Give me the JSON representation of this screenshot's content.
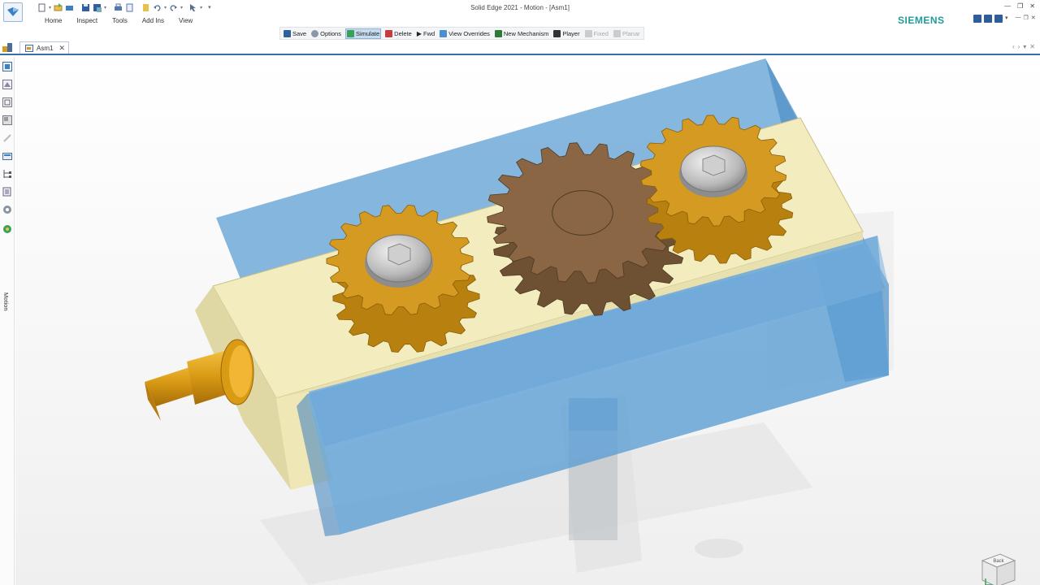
{
  "window": {
    "title": "Solid Edge 2021 - Motion - [Asm1]",
    "brand": "SIEMENS"
  },
  "ribbon": {
    "tabs": [
      "Home",
      "Inspect",
      "Tools",
      "Add Ins",
      "View"
    ]
  },
  "commandbar": {
    "save": "Save",
    "options": "Options",
    "simulate": "Simulate",
    "delete": "Delete",
    "fwd": "Fwd",
    "view_overrides": "View Overrides",
    "new_mechanism": "New Mechanism",
    "player": "Player",
    "fixed": "Fixed",
    "planar": "Planar"
  },
  "document": {
    "tab": "Asm1"
  },
  "siderail": {
    "label": "Motion"
  },
  "viewcube": {
    "top": "Back"
  },
  "colors": {
    "accent": "#3b6ea5",
    "brand": "#1e9c9a",
    "gear_brass": "#d49a22",
    "gear_bronze": "#8a6644",
    "housing_blue": "#5d9fd4",
    "plate_cream": "#f0e8b8"
  },
  "icons": {
    "app": "solid-edge-app-icon",
    "qat": [
      "new-icon",
      "open-icon",
      "save-icon",
      "print-icon",
      "undo-icon",
      "redo-icon"
    ],
    "rail": [
      "assembly-icon",
      "pathfinder-icon",
      "layers-icon",
      "sensors-icon",
      "views-icon",
      "libraries-icon",
      "tree-icon",
      "document-icon",
      "gear-icon",
      "motion-icon"
    ]
  }
}
